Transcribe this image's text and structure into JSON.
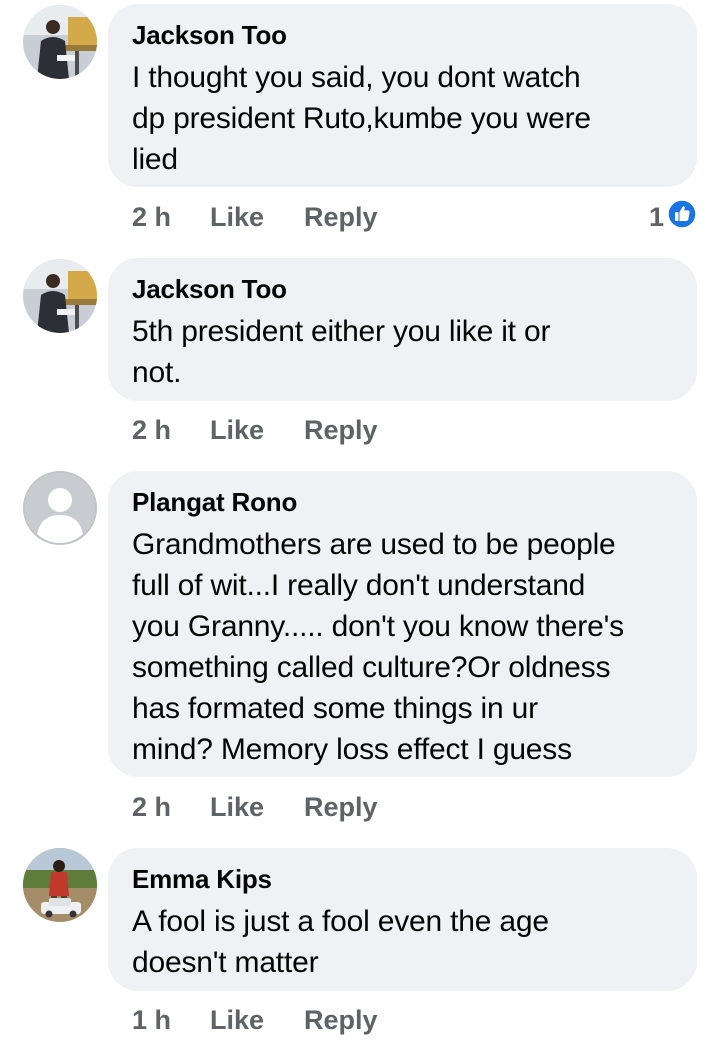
{
  "comments": [
    {
      "author": "Jackson Too",
      "text_lines": [
        "I thought you said, you dont watch",
        "dp president Ruto,kumbe you were",
        "lied"
      ],
      "time": "2 h",
      "like_label": "Like",
      "reply_label": "Reply",
      "reaction_count": "1"
    },
    {
      "author": "Jackson Too",
      "text_lines": [
        "5th president  either you like it or",
        "not."
      ],
      "time": "2 h",
      "like_label": "Like",
      "reply_label": "Reply"
    },
    {
      "author": "Plangat Rono",
      "text_lines": [
        "Grandmothers are used to be people",
        "full of wit...I really don't understand",
        "you Granny..... don't you know there's",
        "something called culture?Or oldness",
        "has formated some things in ur",
        "mind? Memory loss effect I guess"
      ],
      "time": "2 h",
      "like_label": "Like",
      "reply_label": "Reply"
    },
    {
      "author": "Emma Kips",
      "text_lines": [
        "A fool is just a fool even the age",
        "doesn't  matter"
      ],
      "time": "1 h",
      "like_label": "Like",
      "reply_label": "Reply"
    }
  ],
  "icons": {
    "reaction": "like-thumb-icon",
    "default_avatar": "default-avatar-icon"
  },
  "colors": {
    "bubble": "#eff1f4",
    "meta_text": "#5f6368",
    "like_blue": "#1b74e4"
  }
}
